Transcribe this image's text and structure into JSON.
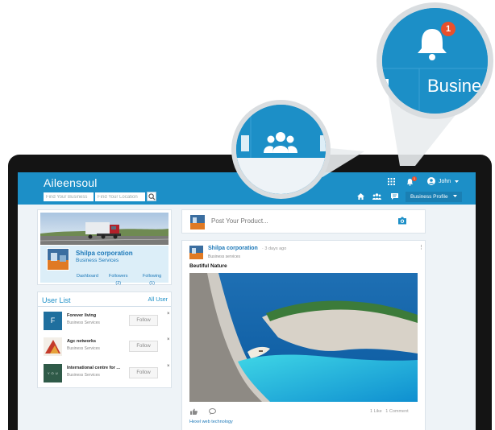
{
  "header": {
    "logo": "Aileensoul",
    "search_placeholder": "Find Your Business",
    "location_placeholder": "Find Your Location",
    "notification_count": "1",
    "user_name": "John",
    "profile_menu": "Business Profile"
  },
  "profile": {
    "company_name": "Shilpa corporation",
    "company_type": "Business Services",
    "stats": [
      {
        "label": "Dashboard",
        "value": ""
      },
      {
        "label": "Followers",
        "value": "(2)"
      },
      {
        "label": "Following",
        "value": "(1)"
      }
    ]
  },
  "user_list": {
    "title": "User List",
    "all_link": "All User",
    "follow_label": "Follow",
    "close_glyph": "×",
    "users": [
      {
        "name": "Forever living",
        "category": "Business Services",
        "avatar_text": "F",
        "avatar_color": "#1f6f9e"
      },
      {
        "name": "Agc networks",
        "category": "Business Services",
        "avatar_text": "",
        "avatar_color": "#c43a2a"
      },
      {
        "name": "International centre for ...",
        "category": "Business Services",
        "avatar_text": "Y O U",
        "avatar_color": "#2f5a48"
      }
    ]
  },
  "composer": {
    "placeholder": "Post Your Product..."
  },
  "post": {
    "author": "Shilpa corporation",
    "time": "· 3 days ago",
    "category": "Business services",
    "title": "Beutiful Nature",
    "more_glyph": "⋮",
    "counts": "1 Like   1 Comment",
    "footer": "Hexel web technology"
  },
  "callouts": {
    "big_text": "Busine",
    "big_badge": "1"
  },
  "colors": {
    "brand": "#1c8fc7",
    "link": "#1c78b8",
    "badge": "#e8502c"
  },
  "icons": [
    "search-icon",
    "apps-grid-icon",
    "bell-icon",
    "user-icon",
    "chevron-down-icon",
    "home-icon",
    "users-icon",
    "message-icon",
    "camera-icon",
    "like-icon",
    "comment-icon",
    "close-icon"
  ]
}
